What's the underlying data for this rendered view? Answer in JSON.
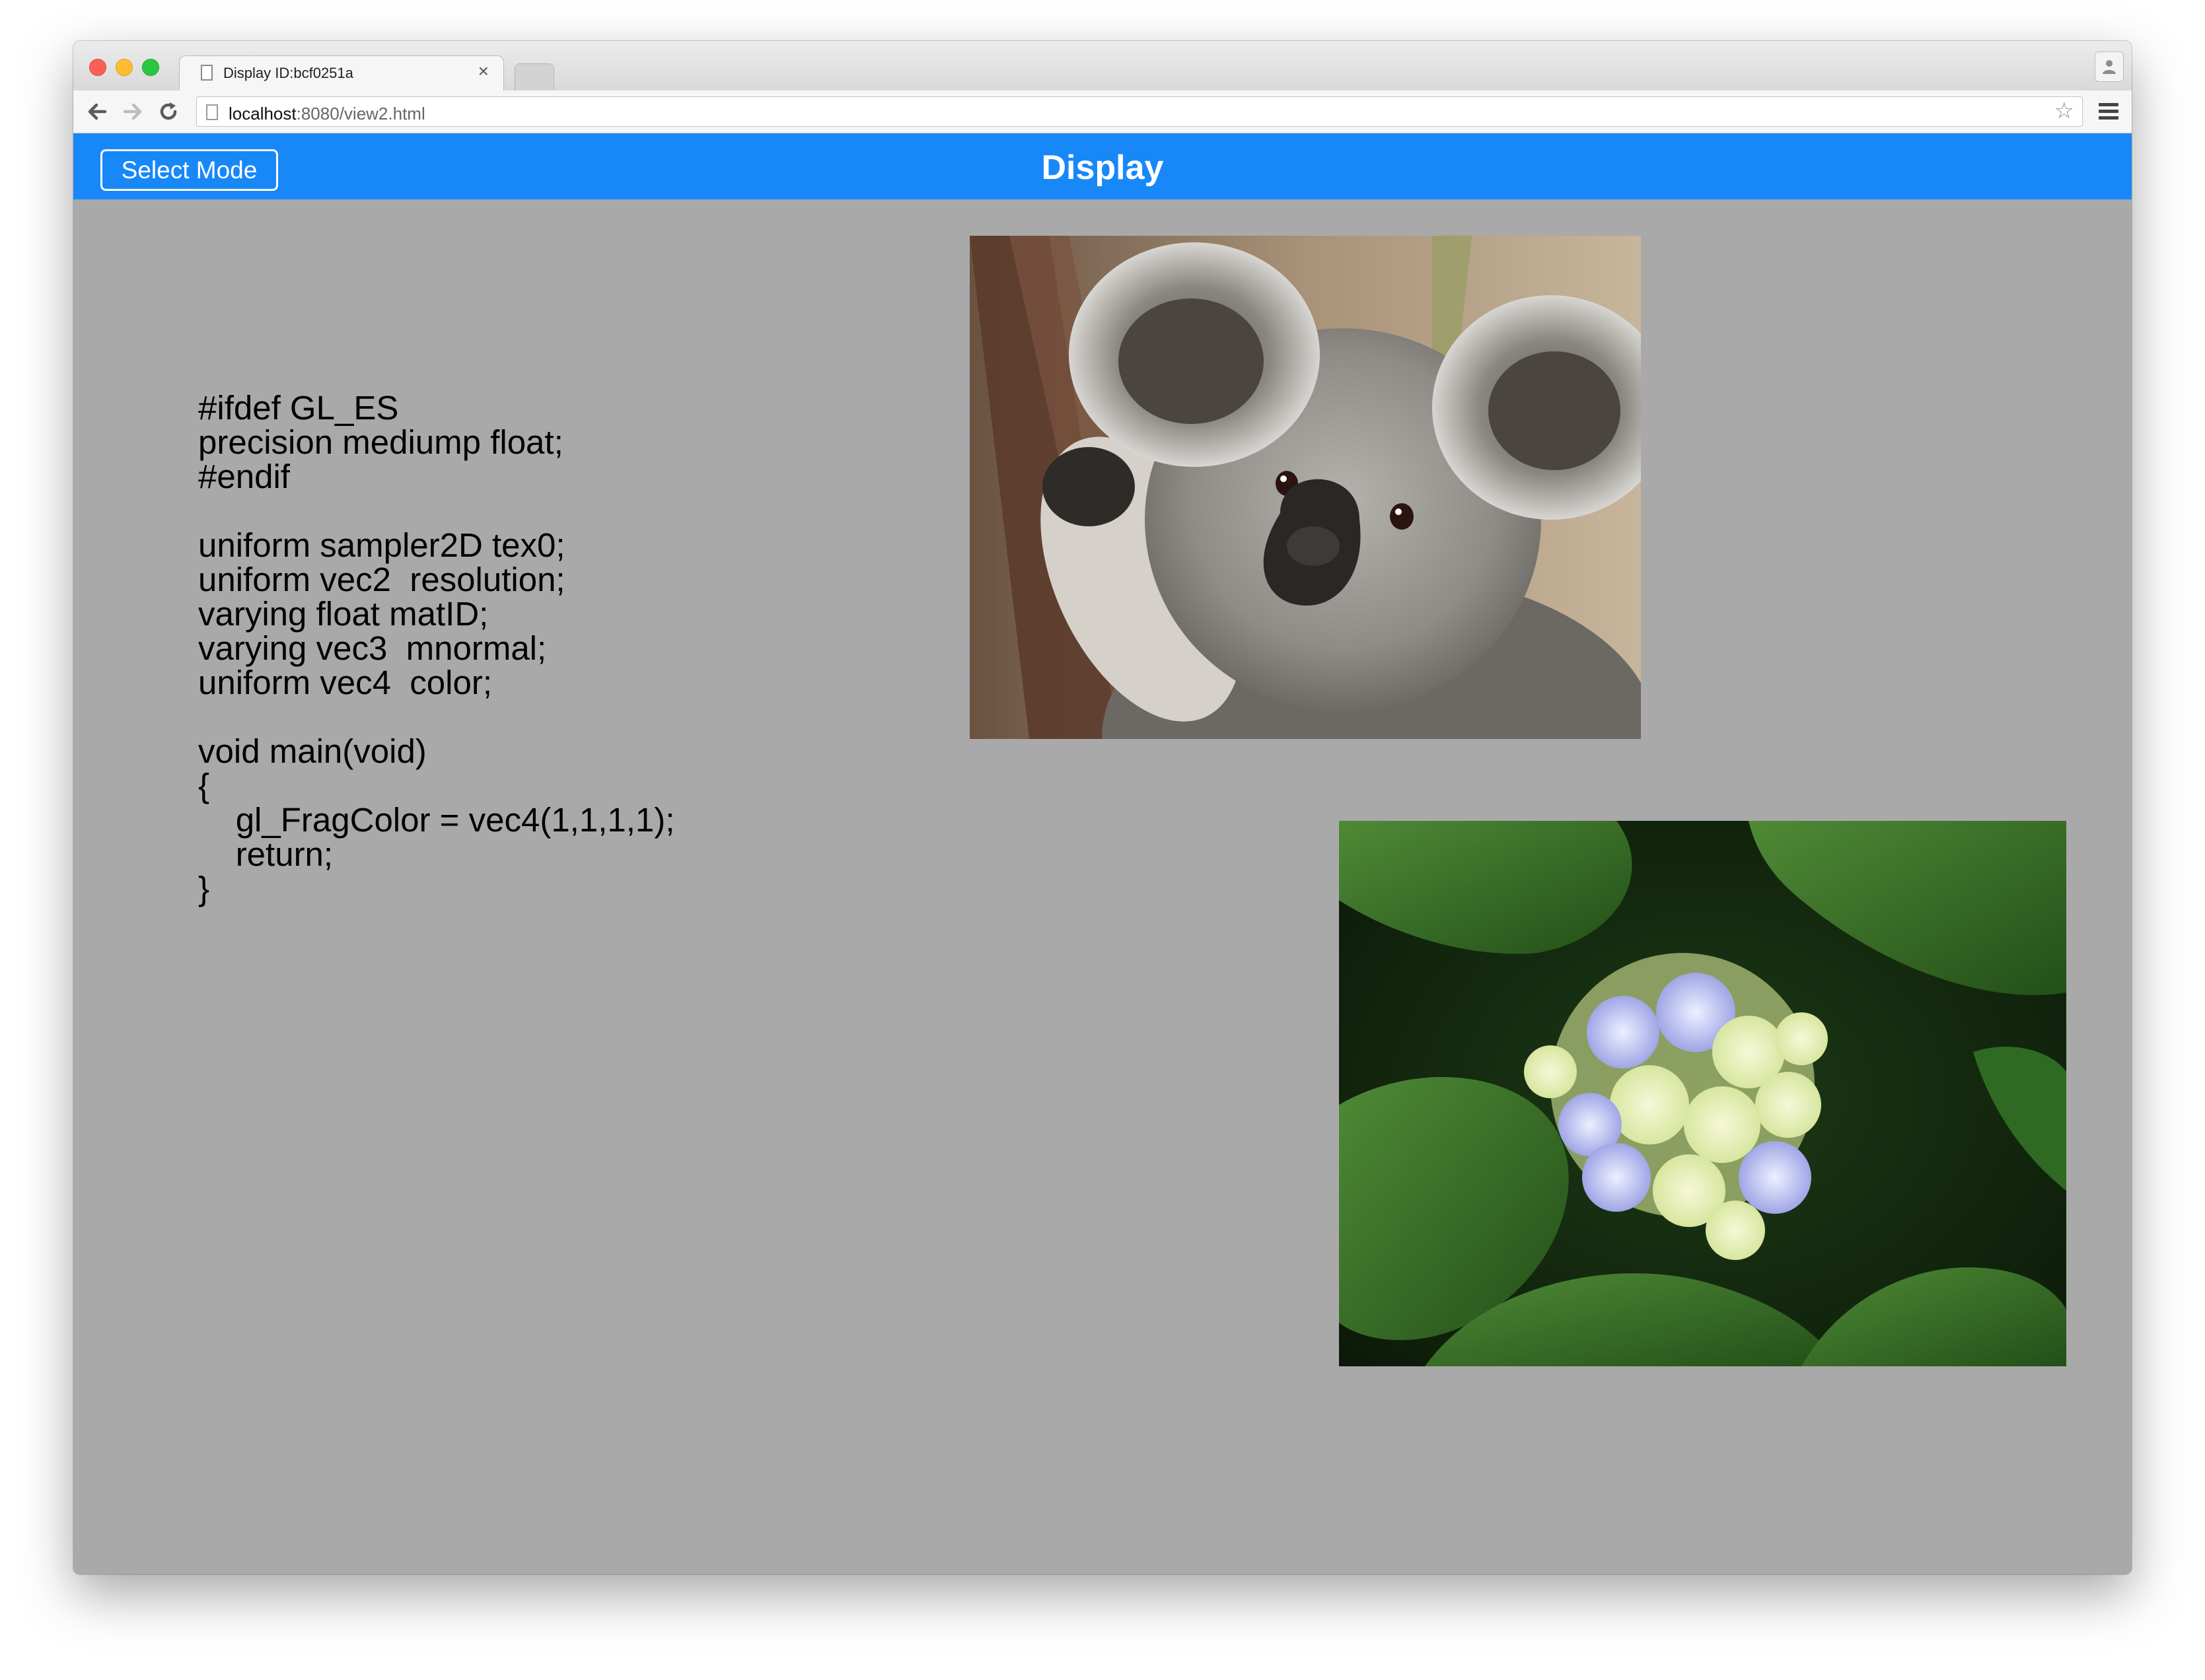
{
  "browser": {
    "tab_title": "Display ID:bcf0251a",
    "tab_close": "×",
    "url_host": "localhost",
    "url_rest": ":8080/view2.html",
    "star": "☆"
  },
  "header": {
    "mode_button": "Select Mode",
    "title": "Display"
  },
  "code": {
    "text": "#ifdef GL_ES\nprecision mediump float;\n#endif\n\nuniform sampler2D tex0;\nuniform vec2  resolution;\nvarying float matID;\nvarying vec3  mnormal;\nuniform vec4  color;\n\nvoid main(void)\n{\n\tgl_FragColor = vec4(1,1,1,1);\n\treturn;\n}"
  },
  "images": {
    "koala": "koala-photo",
    "flower": "hydrangea-photo"
  },
  "colors": {
    "header_bg": "#1888f9",
    "content_bg": "#a9a9a9"
  }
}
